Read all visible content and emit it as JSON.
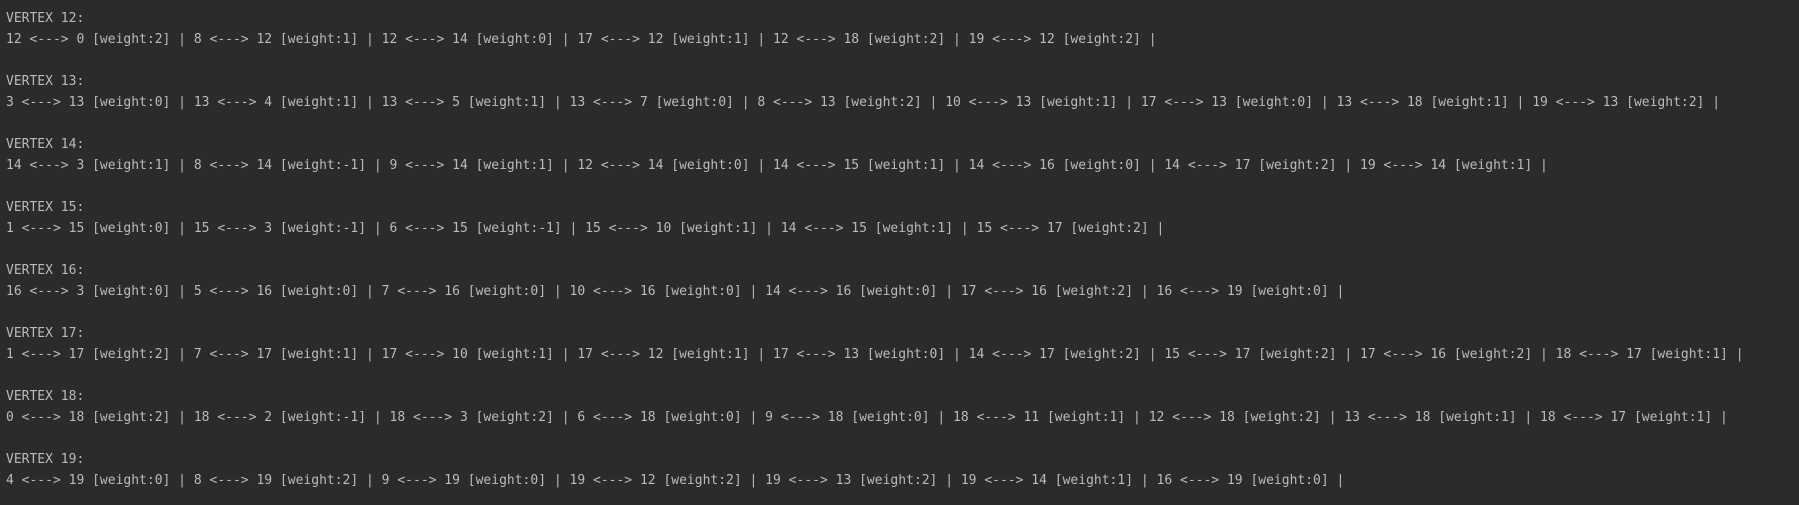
{
  "console": {
    "blocks": [
      {
        "header": "VERTEX 12:",
        "edges": "12 <---> 0 [weight:2] | 8 <---> 12 [weight:1] | 12 <---> 14 [weight:0] | 17 <---> 12 [weight:1] | 12 <---> 18 [weight:2] | 19 <---> 12 [weight:2] |"
      },
      {
        "header": "VERTEX 13:",
        "edges": "3 <---> 13 [weight:0] | 13 <---> 4 [weight:1] | 13 <---> 5 [weight:1] | 13 <---> 7 [weight:0] | 8 <---> 13 [weight:2] | 10 <---> 13 [weight:1] | 17 <---> 13 [weight:0] | 13 <---> 18 [weight:1] | 19 <---> 13 [weight:2] |"
      },
      {
        "header": "VERTEX 14:",
        "edges": "14 <---> 3 [weight:1] | 8 <---> 14 [weight:-1] | 9 <---> 14 [weight:1] | 12 <---> 14 [weight:0] | 14 <---> 15 [weight:1] | 14 <---> 16 [weight:0] | 14 <---> 17 [weight:2] | 19 <---> 14 [weight:1] |"
      },
      {
        "header": "VERTEX 15:",
        "edges": "1 <---> 15 [weight:0] | 15 <---> 3 [weight:-1] | 6 <---> 15 [weight:-1] | 15 <---> 10 [weight:1] | 14 <---> 15 [weight:1] | 15 <---> 17 [weight:2] |"
      },
      {
        "header": "VERTEX 16:",
        "edges": "16 <---> 3 [weight:0] | 5 <---> 16 [weight:0] | 7 <---> 16 [weight:0] | 10 <---> 16 [weight:0] | 14 <---> 16 [weight:0] | 17 <---> 16 [weight:2] | 16 <---> 19 [weight:0] |"
      },
      {
        "header": "VERTEX 17:",
        "edges": "1 <---> 17 [weight:2] | 7 <---> 17 [weight:1] | 17 <---> 10 [weight:1] | 17 <---> 12 [weight:1] | 17 <---> 13 [weight:0] | 14 <---> 17 [weight:2] | 15 <---> 17 [weight:2] | 17 <---> 16 [weight:2] | 18 <---> 17 [weight:1] |"
      },
      {
        "header": "VERTEX 18:",
        "edges": "0 <---> 18 [weight:2] | 18 <---> 2 [weight:-1] | 18 <---> 3 [weight:2] | 6 <---> 18 [weight:0] | 9 <---> 18 [weight:0] | 18 <---> 11 [weight:1] | 12 <---> 18 [weight:2] | 13 <---> 18 [weight:1] | 18 <---> 17 [weight:1] |"
      },
      {
        "header": "VERTEX 19:",
        "edges": "4 <---> 19 [weight:0] | 8 <---> 19 [weight:2] | 9 <---> 19 [weight:0] | 19 <---> 12 [weight:2] | 19 <---> 13 [weight:2] | 19 <---> 14 [weight:1] | 16 <---> 19 [weight:0] |"
      }
    ],
    "colors": {
      "background": "#2b2b2b",
      "text": "#bbbbbb"
    }
  }
}
